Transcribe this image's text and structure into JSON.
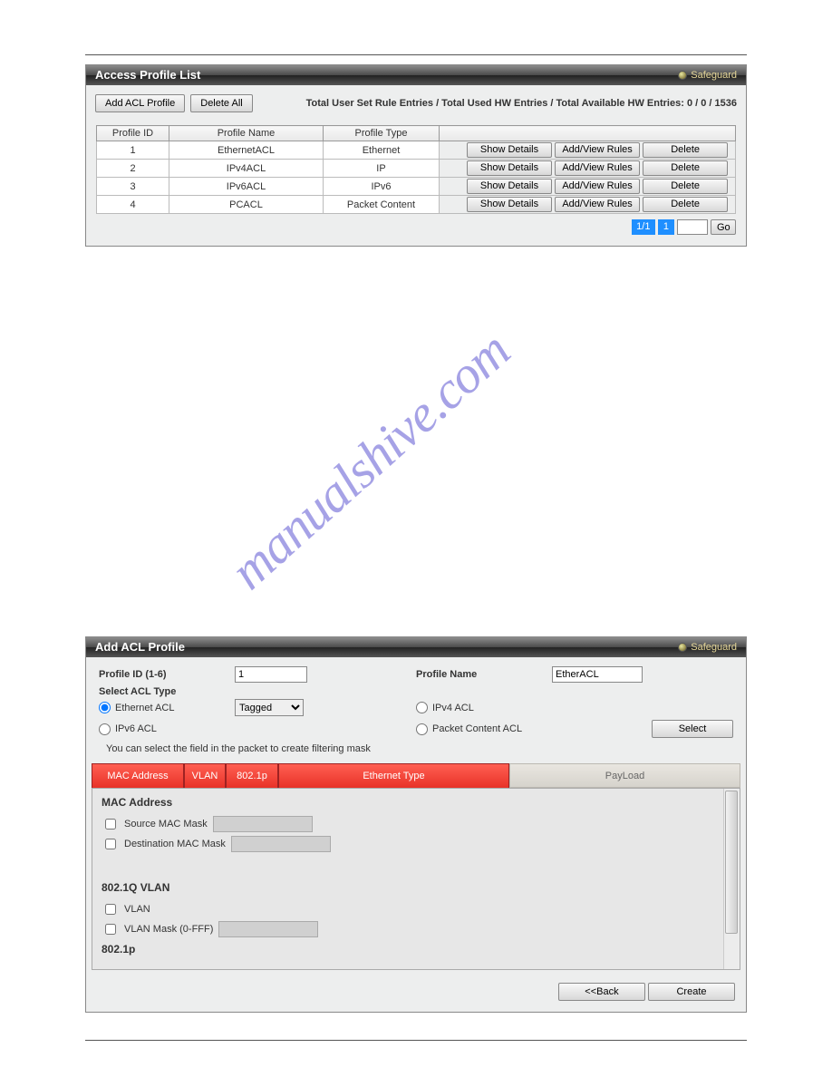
{
  "watermark": "manualshive.com",
  "panel1": {
    "title": "Access Profile List",
    "safeguard": "Safeguard",
    "add_btn": "Add ACL Profile",
    "delete_all_btn": "Delete All",
    "summary": "Total User Set Rule Entries / Total Used HW Entries / Total Available HW Entries: 0 / 0 / 1536",
    "headers": [
      "Profile ID",
      "Profile Name",
      "Profile Type",
      ""
    ],
    "btns": {
      "show": "Show Details",
      "rules": "Add/View Rules",
      "del": "Delete"
    },
    "rows": [
      {
        "id": "1",
        "name": "EthernetACL",
        "type": "Ethernet"
      },
      {
        "id": "2",
        "name": "IPv4ACL",
        "type": "IP"
      },
      {
        "id": "3",
        "name": "IPv6ACL",
        "type": "IPv6"
      },
      {
        "id": "4",
        "name": "PCACL",
        "type": "Packet Content"
      }
    ],
    "pager": {
      "pages": "1/1",
      "cur": "1",
      "go": "Go"
    }
  },
  "panel2": {
    "title": "Add ACL Profile",
    "safeguard": "Safeguard",
    "profile_id_lbl": "Profile ID (1-6)",
    "profile_id_val": "1",
    "profile_name_lbl": "Profile Name",
    "profile_name_val": "EtherACL",
    "select_type_lbl": "Select ACL Type",
    "eth_lbl": "Ethernet ACL",
    "tagged": "Tagged",
    "ipv4_lbl": "IPv4 ACL",
    "ipv6_lbl": "IPv6 ACL",
    "pc_lbl": "Packet Content ACL",
    "select_btn": "Select",
    "hint": "You can select the field in the packet to create filtering mask",
    "tabs": {
      "mac": "MAC Address",
      "vlan": "VLAN",
      "p8021": "802.1p",
      "eth": "Ethernet Type",
      "payload": "PayLoad"
    },
    "sec_mac": "MAC Address",
    "src_mask": "Source MAC Mask",
    "dst_mask": "Destination MAC Mask",
    "sec_vlan": "802.1Q VLAN",
    "vlan_chk": "VLAN",
    "vlan_mask": "VLAN Mask (0-FFF)",
    "sec_8021p": "802.1p",
    "back_btn": "<<Back",
    "create_btn": "Create"
  }
}
